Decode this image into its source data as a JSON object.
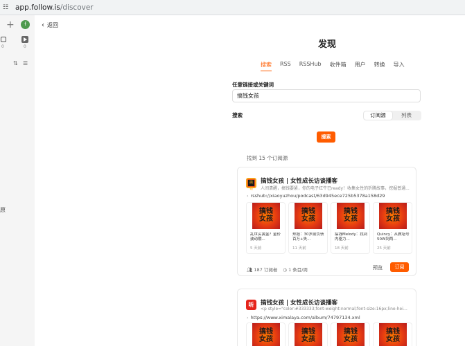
{
  "browser": {
    "url_host": "app.follow.is",
    "url_path": "/discover"
  },
  "sidebar": {
    "avatar_letter": "f",
    "img_count": "0",
    "video_count": "0",
    "edge_text": "原"
  },
  "main": {
    "back_label": "返回",
    "title": "发现",
    "tabs": [
      {
        "label": "搜索",
        "active": true
      },
      {
        "label": "RSS"
      },
      {
        "label": "RSSHub"
      },
      {
        "label": "收件箱"
      },
      {
        "label": "用户"
      },
      {
        "label": "转换"
      },
      {
        "label": "导入"
      }
    ],
    "keyword_label": "任意链接或关键词",
    "keyword_value": "搞钱女孩",
    "search_label": "搜索",
    "segment": [
      "订阅源",
      "列表"
    ],
    "search_button": "搜索",
    "found_text": "找到 15 个订阅源"
  },
  "cards": [
    {
      "title": "搞钱女孩 | 女性成长访谈播客",
      "desc": "人间清醒，搞钱要紧，你的电子红牛已ready！收集女性的折腾故事，挖掘普通...",
      "link": "rsshub://xiaoyuzhou/podcast/63d945ece725b5378a158d29",
      "items": [
        {
          "title": "乱世买黄金？金价波动期...",
          "date": "5 天前"
        },
        {
          "title": "郑旭：30岁前负债百万+失...",
          "date": "11 天前"
        },
        {
          "title": "搞钱Melody：找到内驱力...",
          "date": "18 天前"
        },
        {
          "title": "Quincy：从教培号50W到两...",
          "date": "25 天前"
        }
      ],
      "subscribers": "187 订阅者",
      "frequency": "1 条目/周",
      "preview": "预览",
      "subscribe": "订阅"
    },
    {
      "title": "搞钱女孩 | 女性成长访谈播客",
      "desc": "<p style=\"color:#333333;font-weight:normal;font-size:16px;line-height:30px;fo...",
      "link": "https://www.ximalaya.com/album/74797134.xml",
      "logo": "听"
    }
  ],
  "thumb_text": [
    "搞钱",
    "女孩"
  ]
}
